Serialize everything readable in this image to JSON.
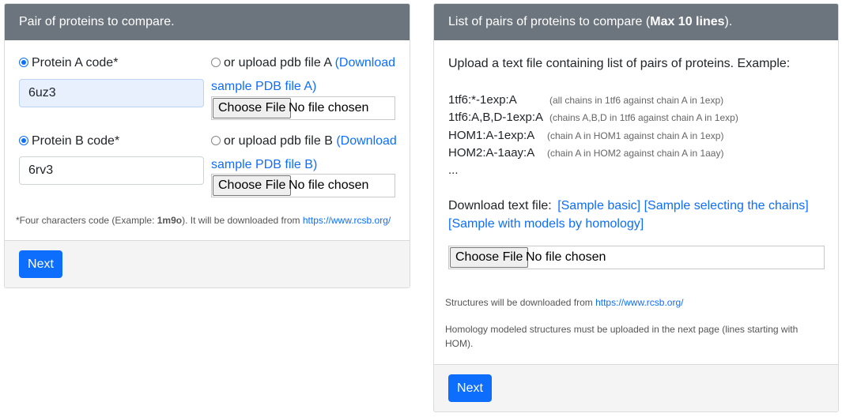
{
  "left_card": {
    "header": "Pair of proteins to compare.",
    "protein_a": {
      "radio_label": "Protein A code*",
      "code_value": "6uz3",
      "upload_label": "or upload pdb file A",
      "download_link_1": "(Download",
      "download_link_2": "sample PDB file A)",
      "choose_button": "Choose File",
      "no_file": "No file chosen"
    },
    "protein_b": {
      "radio_label": "Protein B code*",
      "code_value": "6rv3",
      "upload_label": "or upload pdb file B",
      "download_link_1": "(Download",
      "download_link_2": "sample PDB file B)",
      "choose_button": "Choose File",
      "no_file": "No file chosen"
    },
    "footnote_prefix": "*Four characters code (Example: ",
    "footnote_example": "1m9o",
    "footnote_mid": "). It will be downloaded from ",
    "footnote_link": "https://www.rcsb.org/",
    "next_button": "Next"
  },
  "right_card": {
    "header_main": "List of pairs of proteins to compare (",
    "header_bold": "Max 10 lines",
    "header_end": ").",
    "intro": "Upload a text file containing list of pairs of proteins. Example:",
    "examples": [
      {
        "code": "1tf6:*-1exp:A",
        "desc": "(all chains in 1tf6 against chain A in 1exp)"
      },
      {
        "code": "1tf6:A,B,D-1exp:A",
        "desc": "(chains A,B,D in 1tf6 against chain A in 1exp)"
      },
      {
        "code": "HOM1:A-1exp:A",
        "desc": "(chain A in HOM1 against chain A in 1exp)"
      },
      {
        "code": "HOM2:A-1aay:A",
        "desc": "(chain A in HOM2 against chain A in 1aay)"
      }
    ],
    "ellipsis": "...",
    "download_label": "Download text file:",
    "sample_basic": "[Sample basic]",
    "sample_chains": "[Sample selecting the chains]",
    "sample_homology": "[Sample with models by homology]",
    "choose_button": "Choose File",
    "no_file": "No file chosen",
    "structures_prefix": "Structures will be downloaded from ",
    "structures_link": "https://www.rcsb.org/",
    "homology_note_1": "Homology modeled structures must be uploaded in the next page (lines starting with",
    "homology_note_2": "HOM).",
    "next_button": "Next"
  }
}
